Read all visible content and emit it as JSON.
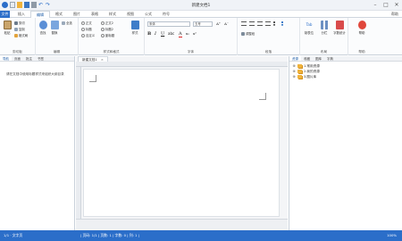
{
  "window": {
    "title": "新建文档1"
  },
  "menu": {
    "file": "文件",
    "tabs": [
      "文件",
      "插入",
      "编辑",
      "格式",
      "图片",
      "表格",
      "样式",
      "视图",
      "公式",
      "符号"
    ],
    "active_tab": "编辑",
    "right": "帮助"
  },
  "ribbon": {
    "groups": {
      "clipboard": "剪切板",
      "edit": "编辑",
      "style": "样式和格式",
      "font": "字体",
      "paragraph": "段落",
      "layout": "布局",
      "help": "帮助"
    },
    "paste": "粘贴",
    "cut": "剪切",
    "copy": "复制",
    "format_painter": "格式刷",
    "find": "查找",
    "replace": "替换",
    "select_all": "全选",
    "styles": [
      "正文",
      "标题",
      "自定义",
      "正文2",
      "标题2",
      "副标题"
    ],
    "style_btn": "样式",
    "font_name": "宋体",
    "font_size": "五号",
    "para_btn": "调整段",
    "dialog": "段落设置",
    "tab": "Tab",
    "tab_label": "制表位",
    "column": "分栏",
    "word_count": "字数统计",
    "help_btn": "帮助"
  },
  "nav": {
    "tabs": [
      "导航",
      "页面",
      "批注",
      "书签"
    ],
    "message": "请在文档中使用标题样式来组织大纲目录"
  },
  "doc": {
    "tab": "新建文档1",
    "status": [
      "页码:1",
      "页数:1",
      "字数:0",
      "列:1"
    ]
  },
  "resource": {
    "tabs": [
      "资源",
      "收藏",
      "图库",
      "字典"
    ],
    "items": [
      "1.常用资源",
      "2.我的资源",
      "3.图片库"
    ]
  },
  "statusbar": {
    "page": "1/1 · 文字页",
    "info": "| 页码: 1/1  |  页数: 1  |  字数: 0  |  列: 1  |",
    "zoom": "100%"
  },
  "colors": {
    "accent": "#2b6ec9",
    "folder": "#f0b33c"
  }
}
